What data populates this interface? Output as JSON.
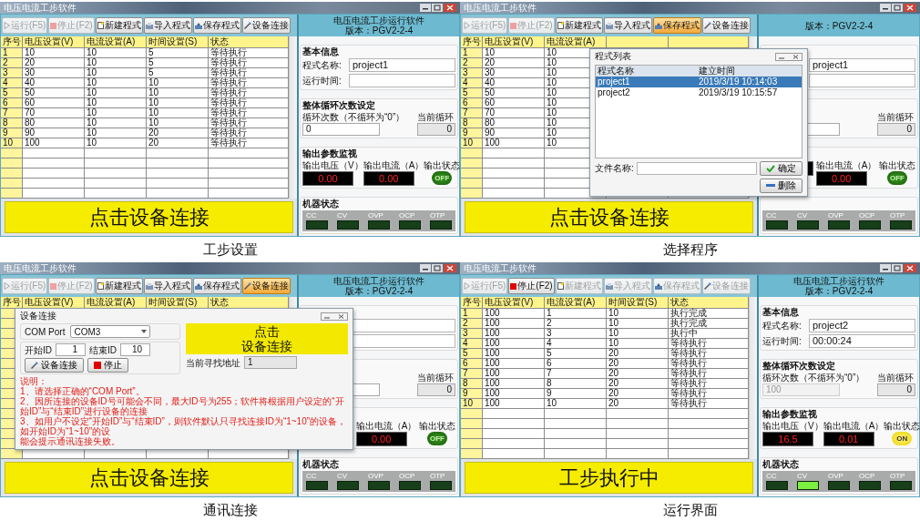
{
  "panels": [
    {
      "caption": "工步设置",
      "window": {
        "title": "电压电流工步软件",
        "toolbar": [
          {
            "label": "运行(F5)",
            "disabled": true,
            "highlighted": false
          },
          {
            "label": "停止(F2)",
            "disabled": true,
            "highlighted": false
          },
          {
            "label": "新建程式",
            "disabled": false,
            "highlighted": false
          },
          {
            "label": "导入程式",
            "disabled": false,
            "highlighted": false
          },
          {
            "label": "保存程式",
            "disabled": false,
            "highlighted": false
          },
          {
            "label": "设备连接",
            "disabled": false,
            "highlighted": false
          }
        ],
        "table": {
          "columns": [
            "序号",
            "电压设置(V)",
            "电流设置(A)",
            "时间设置(S)",
            "状态"
          ],
          "rows": [
            [
              "1",
              "10",
              "10",
              "5",
              "等待执行"
            ],
            [
              "2",
              "20",
              "10",
              "5",
              "等待执行"
            ],
            [
              "3",
              "30",
              "10",
              "5",
              "等待执行"
            ],
            [
              "4",
              "40",
              "10",
              "10",
              "等待执行"
            ],
            [
              "5",
              "50",
              "10",
              "10",
              "等待执行"
            ],
            [
              "6",
              "60",
              "10",
              "10",
              "等待执行"
            ],
            [
              "7",
              "70",
              "10",
              "10",
              "等待执行"
            ],
            [
              "8",
              "80",
              "10",
              "10",
              "等待执行"
            ],
            [
              "9",
              "90",
              "10",
              "20",
              "等待执行"
            ],
            [
              "10",
              "100",
              "10",
              "20",
              "等待执行"
            ]
          ]
        },
        "banner": "点击设备连接",
        "info": {
          "header_title": "电压电流工步运行软件",
          "version": "版本：PGV2-2-4",
          "basic_title": "基本信息",
          "name_label": "程式名称:",
          "name_value": "project1",
          "time_label": "运行时间:",
          "loop_title": "整体循环次数设定",
          "loop_label": "循环次数（不循环为“0”）",
          "loop_value": "0",
          "loop_disabled": false,
          "current_loop_label": "当前循环",
          "current_loop_value": "0",
          "output_title": "输出参数监视",
          "voltage_label": "输出电压（V）",
          "voltage_value": "0.00",
          "current_label": "输出电流（A）",
          "current_value": "0.00",
          "state_label": "输出状态",
          "state_text": "OFF",
          "state_on": false,
          "machine_title": "机器状态",
          "indicators": [
            {
              "label": "CC",
              "lit": false
            },
            {
              "label": "CV",
              "lit": false
            },
            {
              "label": "OVP",
              "lit": false
            },
            {
              "label": "OCP",
              "lit": false
            },
            {
              "label": "OTP",
              "lit": false
            }
          ]
        }
      }
    },
    {
      "caption": "选择程序",
      "window": {
        "title": "电压电流工步软件",
        "toolbar": [
          {
            "label": "运行(F5)",
            "disabled": true,
            "highlighted": false
          },
          {
            "label": "停止(F2)",
            "disabled": true,
            "highlighted": false
          },
          {
            "label": "新建程式",
            "disabled": false,
            "highlighted": false
          },
          {
            "label": "导入程式",
            "disabled": false,
            "highlighted": false
          },
          {
            "label": "保存程式",
            "disabled": false,
            "highlighted": true
          },
          {
            "label": "设备连接",
            "disabled": false,
            "highlighted": false
          }
        ],
        "table": {
          "columns": [
            "序号",
            "电压设置(V)",
            "电流设置(A)"
          ],
          "rows": [
            [
              "1",
              "10",
              "10"
            ],
            [
              "2",
              "20",
              "10"
            ],
            [
              "3",
              "30",
              "10"
            ],
            [
              "4",
              "40",
              "10"
            ],
            [
              "5",
              "50",
              "10"
            ],
            [
              "6",
              "60",
              "10"
            ],
            [
              "7",
              "70",
              "10"
            ],
            [
              "8",
              "80",
              "10"
            ],
            [
              "9",
              "90",
              "10"
            ],
            [
              "10",
              "100",
              "10"
            ]
          ]
        },
        "banner": "点击设备连接",
        "info": {
          "version": "版本：PGV2-2-4",
          "name_value": "project1",
          "loop_disabled": false,
          "current_loop_label": "当前循环",
          "current_loop_value": "0",
          "current_label": "输出电流（A）",
          "current_value": "0.00",
          "state_label": "输出状态",
          "state_text": "OFF",
          "state_on": false,
          "indicators": [
            {
              "label": "CC",
              "lit": false
            },
            {
              "label": "CV",
              "lit": false
            },
            {
              "label": "OVP",
              "lit": false
            },
            {
              "label": "OCP",
              "lit": false
            },
            {
              "label": "OTP",
              "lit": false
            }
          ]
        },
        "dialog": {
          "kind": "program_list",
          "title": "程式列表",
          "columns": [
            "程式名称",
            "建立时间"
          ],
          "rows": [
            {
              "name": "project1",
              "time": "2019/3/19 10:14:03",
              "selected": true
            },
            {
              "name": "project2",
              "time": "2019/3/19 10:15:57",
              "selected": false
            }
          ],
          "file_label": "文件名称:",
          "ok": "确定",
          "delete": "删除"
        }
      }
    },
    {
      "caption": "通讯连接",
      "window": {
        "title": "电压电流工步软件",
        "toolbar": [
          {
            "label": "运行(F5)",
            "disabled": true,
            "highlighted": false
          },
          {
            "label": "停止(F2)",
            "disabled": true,
            "highlighted": false
          },
          {
            "label": "新建程式",
            "disabled": false,
            "highlighted": false
          },
          {
            "label": "导入程式",
            "disabled": false,
            "highlighted": false
          },
          {
            "label": "保存程式",
            "disabled": false,
            "highlighted": false
          },
          {
            "label": "设备连接",
            "disabled": false,
            "highlighted": true
          }
        ],
        "table": {
          "columns": [
            "序号",
            "电压设置(V)",
            "电流设置(A)",
            "时间设置(S)",
            "状态"
          ]
        },
        "banner": "点击设备连接",
        "info": {
          "header_title": "电压电流工步运行软件",
          "version": "版本：PGV2-2-4",
          "loop_disabled": false,
          "current_loop_label": "当前循环",
          "current_loop_value": "0",
          "current_label": "输出电流（A）",
          "current_value": "0.00",
          "state_label": "输出状态",
          "state_text": "OFF",
          "state_on": false,
          "machine_title": "机器状态",
          "indicators": [
            {
              "label": "CC",
              "lit": false
            },
            {
              "label": "CV",
              "lit": false
            },
            {
              "label": "OVP",
              "lit": false
            },
            {
              "label": "OCP",
              "lit": false
            },
            {
              "label": "OTP",
              "lit": false
            }
          ]
        },
        "dialog": {
          "kind": "device_connect",
          "title": "设备连接",
          "port_label": "COM Port",
          "port_value": "COM3",
          "start_label": "开始ID",
          "start_value": "1",
          "end_label": "结束ID",
          "end_value": "10",
          "connect": "设备连接",
          "stop": "停止",
          "prompt": [
            "点击",
            "设备连接"
          ],
          "address_label": "当前寻找地址",
          "address_value": "1",
          "notes_title": "说明：",
          "notes": [
            "1、请选择正确的“COM Port”。",
            "2、因所连接的设备ID号可能会不同，最大ID号为255；软件将根据用户设定的“开始ID”与“结束ID”进行设备的连接",
            "3、如用户不设定“开始ID”与“结束ID”，则软件默认只寻找连接ID为“1~10”的设备，如开始ID为“1~10”的设",
            "能会提示通讯连接失败。"
          ]
        }
      }
    },
    {
      "caption": "运行界面",
      "window": {
        "title": "电压电流工步软件",
        "toolbar": [
          {
            "label": "运行(F5)",
            "disabled": true,
            "highlighted": false
          },
          {
            "label": "停止(F2)",
            "disabled": false,
            "highlighted": false
          },
          {
            "label": "新建程式",
            "disabled": true,
            "highlighted": false
          },
          {
            "label": "导入程式",
            "disabled": true,
            "highlighted": false
          },
          {
            "label": "保存程式",
            "disabled": true,
            "highlighted": false
          },
          {
            "label": "设备连接",
            "disabled": true,
            "highlighted": false
          }
        ],
        "table": {
          "columns": [
            "序号",
            "电压设置(V)",
            "电流设置(A)",
            "时间设置(S)",
            "状态"
          ],
          "rows": [
            [
              "1",
              "100",
              "1",
              "10",
              "执行完成"
            ],
            [
              "2",
              "100",
              "2",
              "10",
              "执行完成"
            ],
            [
              "3",
              "100",
              "3",
              "10",
              "执行中"
            ],
            [
              "4",
              "100",
              "4",
              "10",
              "等待执行"
            ],
            [
              "5",
              "100",
              "5",
              "20",
              "等待执行"
            ],
            [
              "6",
              "100",
              "6",
              "20",
              "等待执行"
            ],
            [
              "7",
              "100",
              "7",
              "20",
              "等待执行"
            ],
            [
              "8",
              "100",
              "8",
              "20",
              "等待执行"
            ],
            [
              "9",
              "100",
              "9",
              "20",
              "等待执行"
            ],
            [
              "10",
              "100",
              "10",
              "20",
              "等待执行"
            ]
          ]
        },
        "banner": "工步执行中",
        "info": {
          "header_title": "电压电流工步运行软件",
          "version": "版本：PGV2-2-4",
          "basic_title": "基本信息",
          "name_label": "程式名称:",
          "name_value": "project2",
          "time_label": "运行时间:",
          "time_value": "00:00:24",
          "loop_title": "整体循环次数设定",
          "loop_label": "循环次数（不循环为“0”）",
          "loop_value": "100",
          "loop_disabled": true,
          "current_loop_label": "当前循环",
          "current_loop_value": "0",
          "output_title": "输出参数监视",
          "voltage_label": "输出电压（V）",
          "voltage_value": "16.5",
          "current_label": "输出电流（A）",
          "current_value": "0.01",
          "state_label": "输出状态",
          "state_text": "ON",
          "state_on": true,
          "machine_title": "机器状态",
          "indicators": [
            {
              "label": "CC",
              "lit": false
            },
            {
              "label": "CV",
              "lit": true
            },
            {
              "label": "OVP",
              "lit": false
            },
            {
              "label": "OCP",
              "lit": false
            },
            {
              "label": "OTP",
              "lit": false
            }
          ]
        }
      }
    }
  ]
}
